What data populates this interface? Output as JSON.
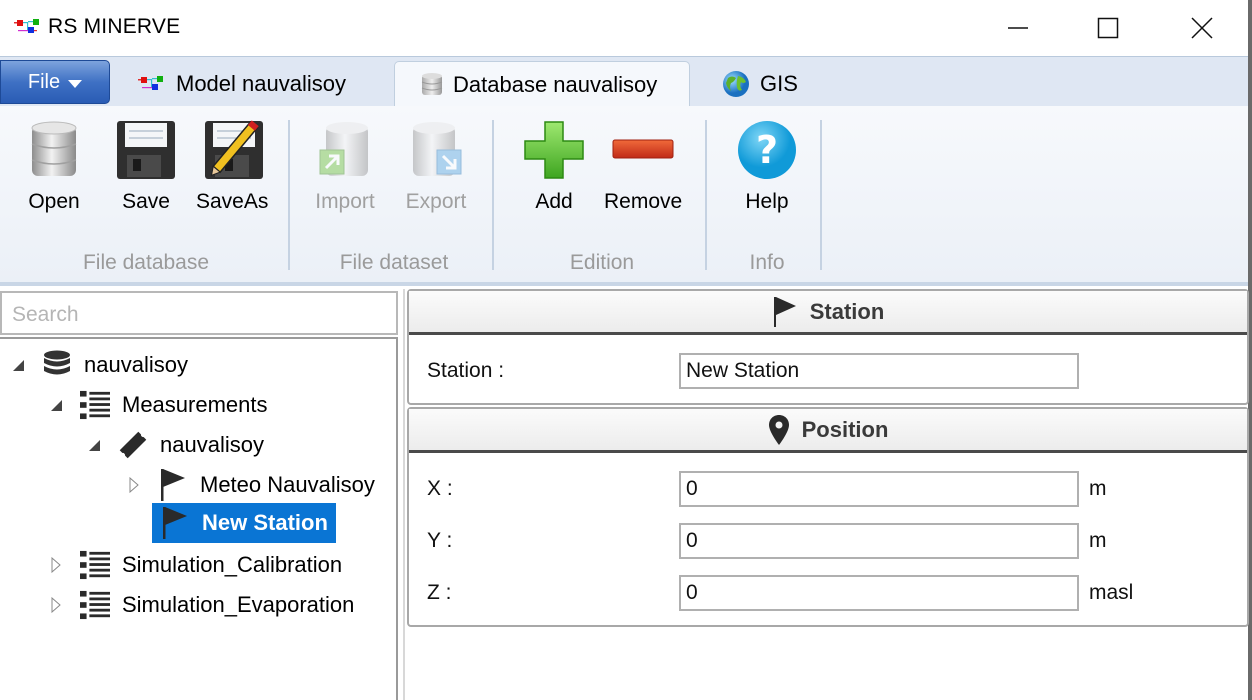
{
  "window": {
    "title": "RS MINERVE",
    "controls": {
      "minimize": "minimize-icon",
      "maximize": "maximize-icon",
      "close": "close-icon"
    }
  },
  "tabs": {
    "file_label": "File",
    "items": [
      {
        "label": "Model nauvalisoy",
        "icon": "model-icon",
        "active": false
      },
      {
        "label": "Database nauvalisoy",
        "icon": "database-icon",
        "active": true
      },
      {
        "label": "GIS",
        "icon": "globe-icon",
        "active": false
      }
    ]
  },
  "ribbon": {
    "groups": [
      {
        "label": "File database",
        "buttons": [
          {
            "label": "Open",
            "icon": "database-icon",
            "enabled": true
          },
          {
            "label": "Save",
            "icon": "floppy-icon",
            "enabled": true
          },
          {
            "label": "SaveAs",
            "icon": "floppy-pencil-icon",
            "enabled": true
          }
        ]
      },
      {
        "label": "File dataset",
        "buttons": [
          {
            "label": "Import",
            "icon": "import-icon",
            "enabled": false
          },
          {
            "label": "Export",
            "icon": "export-icon",
            "enabled": false
          }
        ]
      },
      {
        "label": "Edition",
        "buttons": [
          {
            "label": "Add",
            "icon": "plus-icon",
            "enabled": true
          },
          {
            "label": "Remove",
            "icon": "minus-icon",
            "enabled": true
          }
        ]
      },
      {
        "label": "Info",
        "buttons": [
          {
            "label": "Help",
            "icon": "help-icon",
            "enabled": true
          }
        ]
      }
    ]
  },
  "sidebar": {
    "search_placeholder": "Search",
    "tree": [
      {
        "label": "nauvalisoy",
        "icon": "database-icon",
        "level": 0,
        "expanded": true
      },
      {
        "label": "Measurements",
        "icon": "list-icon",
        "level": 1,
        "expanded": true
      },
      {
        "label": "nauvalisoy",
        "icon": "ticket-icon",
        "level": 2,
        "expanded": true
      },
      {
        "label": "Meteo Nauvalisoy",
        "icon": "flag-icon",
        "level": 3,
        "expanded": false
      },
      {
        "label": "New Station",
        "icon": "flag-icon",
        "level": 3,
        "selected": true
      },
      {
        "label": "Simulation_Calibration",
        "icon": "list-icon",
        "level": 1,
        "expanded": false
      },
      {
        "label": "Simulation_Evaporation",
        "icon": "list-icon",
        "level": 1,
        "expanded": false
      }
    ]
  },
  "detail": {
    "station_panel": {
      "title": "Station",
      "fields": [
        {
          "label": "Station :",
          "value": "New Station"
        }
      ]
    },
    "position_panel": {
      "title": "Position",
      "fields": [
        {
          "label": "X :",
          "value": "0",
          "unit": "m"
        },
        {
          "label": "Y :",
          "value": "0",
          "unit": "m"
        },
        {
          "label": "Z :",
          "value": "0",
          "unit": "masl"
        }
      ]
    }
  },
  "colors": {
    "selection": "#0a75d4",
    "file_button": "#3f71c4",
    "tabstrip": "#dfe7f3"
  }
}
